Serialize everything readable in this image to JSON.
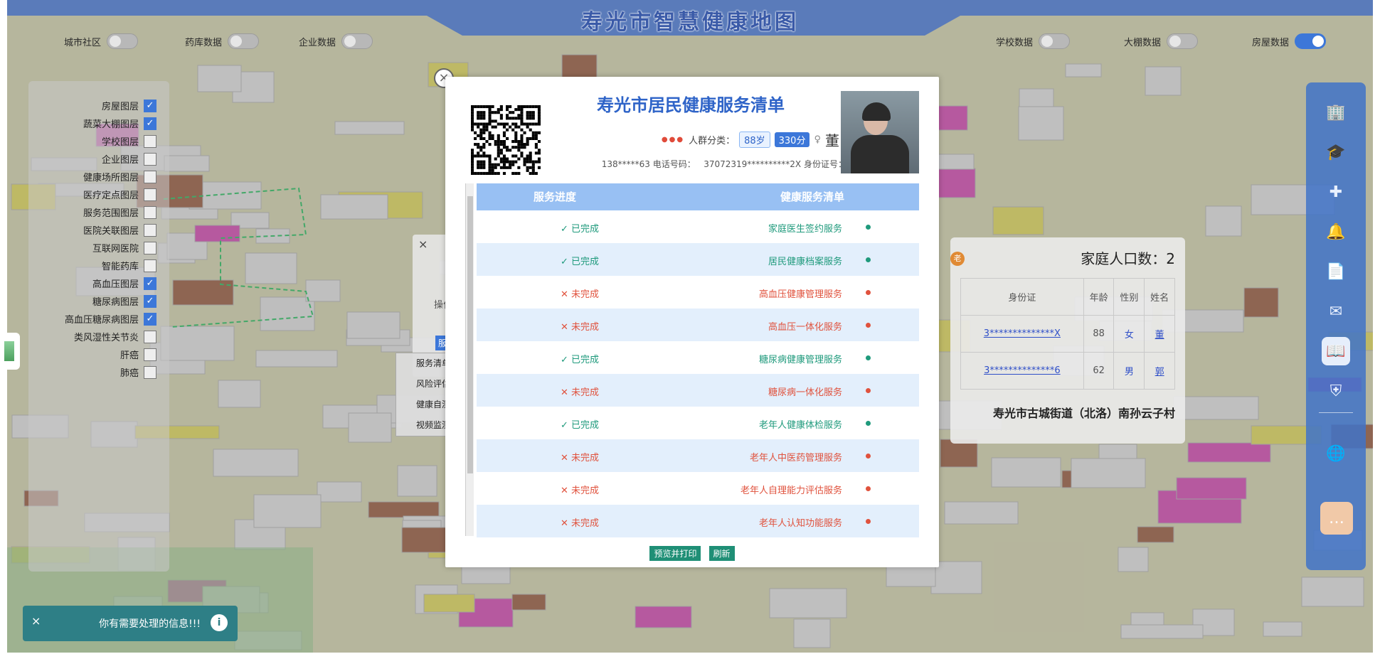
{
  "app": {
    "title": "寿光市智慧健康地图"
  },
  "top_toggles": [
    {
      "label": "城市社区",
      "on": false
    },
    {
      "label": "药库数据",
      "on": false
    },
    {
      "label": "企业数据",
      "on": false
    },
    {
      "label": "学校数据",
      "on": false
    },
    {
      "label": "大棚数据",
      "on": false
    },
    {
      "label": "房屋数据",
      "on": true
    }
  ],
  "layers": [
    {
      "label": "房屋图层",
      "checked": true
    },
    {
      "label": "蔬菜大棚图层",
      "checked": true
    },
    {
      "label": "学校图层",
      "checked": false
    },
    {
      "label": "企业图层",
      "checked": false
    },
    {
      "label": "健康场所图层",
      "checked": false
    },
    {
      "label": "医疗定点图层",
      "checked": false
    },
    {
      "label": "服务范围图层",
      "checked": false
    },
    {
      "label": "医院关联图层",
      "checked": false
    },
    {
      "label": "互联网医院",
      "checked": false
    },
    {
      "label": "智能药库",
      "checked": false
    },
    {
      "label": "高血压图层",
      "checked": true
    },
    {
      "label": "糖尿病图层",
      "checked": true
    },
    {
      "label": "高血压糖尿病图层",
      "checked": true
    },
    {
      "label": "类风湿性关节炎",
      "checked": false
    },
    {
      "label": "肝癌",
      "checked": false
    },
    {
      "label": "肺癌",
      "checked": false
    }
  ],
  "right_bar": {
    "icons": [
      "building-icon",
      "graduation-cap-icon",
      "medical-kit-icon",
      "bell-icon",
      "document-icon",
      "mail-icon",
      "book-icon",
      "shield-icon",
      "globe-icon",
      "chat-icon"
    ],
    "active": "book-icon"
  },
  "family_panel": {
    "title": "家庭人口数：2",
    "badge": "老",
    "headers": [
      "姓名",
      "性别",
      "年龄",
      "身份证"
    ],
    "rows": [
      {
        "name": "董",
        "sex": "女",
        "age": "88",
        "id": "3**************X"
      },
      {
        "name": "郭",
        "sex": "男",
        "age": "62",
        "id": "3**************6"
      }
    ],
    "address": "寿光市古城街道（北洛）南孙云子村"
  },
  "left_popup": {
    "close": "×",
    "col": "操作",
    "btn": "服务"
  },
  "context_menu": [
    "服务清单",
    "风险评估",
    "健康自测",
    "视频监测"
  ],
  "toast": {
    "message": "你有需要处理的信息!!!",
    "close": "×"
  },
  "modal": {
    "title": "寿光市居民健康服务清单",
    "close": "×",
    "name": "董",
    "gender_icon": "♀",
    "age": "88岁",
    "score": "330分",
    "crowd_label": "人群分类：",
    "id_label": "身份证号：",
    "id_value": "37072319**********2X",
    "phone_label": "电话号码：",
    "phone_value": "138*****63",
    "table": {
      "col_service": "健康服务清单",
      "col_progress": "服务进度",
      "rows": [
        {
          "service": "家庭医生签约服务",
          "status": "已完成",
          "mark": "✓",
          "done": true
        },
        {
          "service": "居民健康档案服务",
          "status": "已完成",
          "mark": "✓",
          "done": true
        },
        {
          "service": "高血压健康管理服务",
          "status": "未完成",
          "mark": "✕",
          "done": false
        },
        {
          "service": "高血压一体化服务",
          "status": "未完成",
          "mark": "✕",
          "done": false
        },
        {
          "service": "糖尿病健康管理服务",
          "status": "已完成",
          "mark": "✓",
          "done": true
        },
        {
          "service": "糖尿病一体化服务",
          "status": "未完成",
          "mark": "✕",
          "done": false
        },
        {
          "service": "老年人健康体检服务",
          "status": "已完成",
          "mark": "✓",
          "done": true
        },
        {
          "service": "老年人中医药管理服务",
          "status": "未完成",
          "mark": "✕",
          "done": false
        },
        {
          "service": "老年人自理能力评估服务",
          "status": "未完成",
          "mark": "✕",
          "done": false
        },
        {
          "service": "老年人认知功能服务",
          "status": "未完成",
          "mark": "✕",
          "done": false
        }
      ]
    },
    "buttons": {
      "print": "预览并打印",
      "refresh": "刷新"
    }
  },
  "colors": {
    "accent": "#3c77d9",
    "ok": "#1f9a7c",
    "bad": "#e0523d",
    "header": "#98c0f3",
    "alt_row": "#e3effc"
  }
}
